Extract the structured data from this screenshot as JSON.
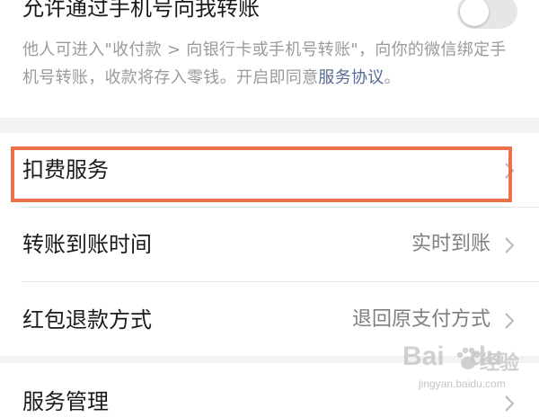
{
  "transfer_setting": {
    "title": "允许通过手机号向我转账",
    "toggle_state": "off",
    "description_prefix": "他人可进入\"收付款 > 向银行卡或手机号转账\"，向你的微信绑定手机号转账，收款将存入零钱。开启即同意",
    "agreement_link": "服务协议",
    "description_suffix": "。"
  },
  "menu": {
    "items": [
      {
        "label": "扣费服务",
        "value": ""
      },
      {
        "label": "转账到账时间",
        "value": "实时到账"
      },
      {
        "label": "红包退款方式",
        "value": "退回原支付方式"
      }
    ],
    "next_section_label": "服务管理"
  },
  "watermark": {
    "brand": "Bai",
    "brand_suffix": "du",
    "cn": "经验",
    "url": "jingyan.baidu.com"
  },
  "colors": {
    "highlight_border": "#ee7048",
    "link": "#576b95",
    "muted_text": "#9a9a9a",
    "value_text": "#7f7f7f",
    "page_background": "#f2f2f2"
  },
  "icons": {
    "chevron": "chevron-right-icon"
  }
}
